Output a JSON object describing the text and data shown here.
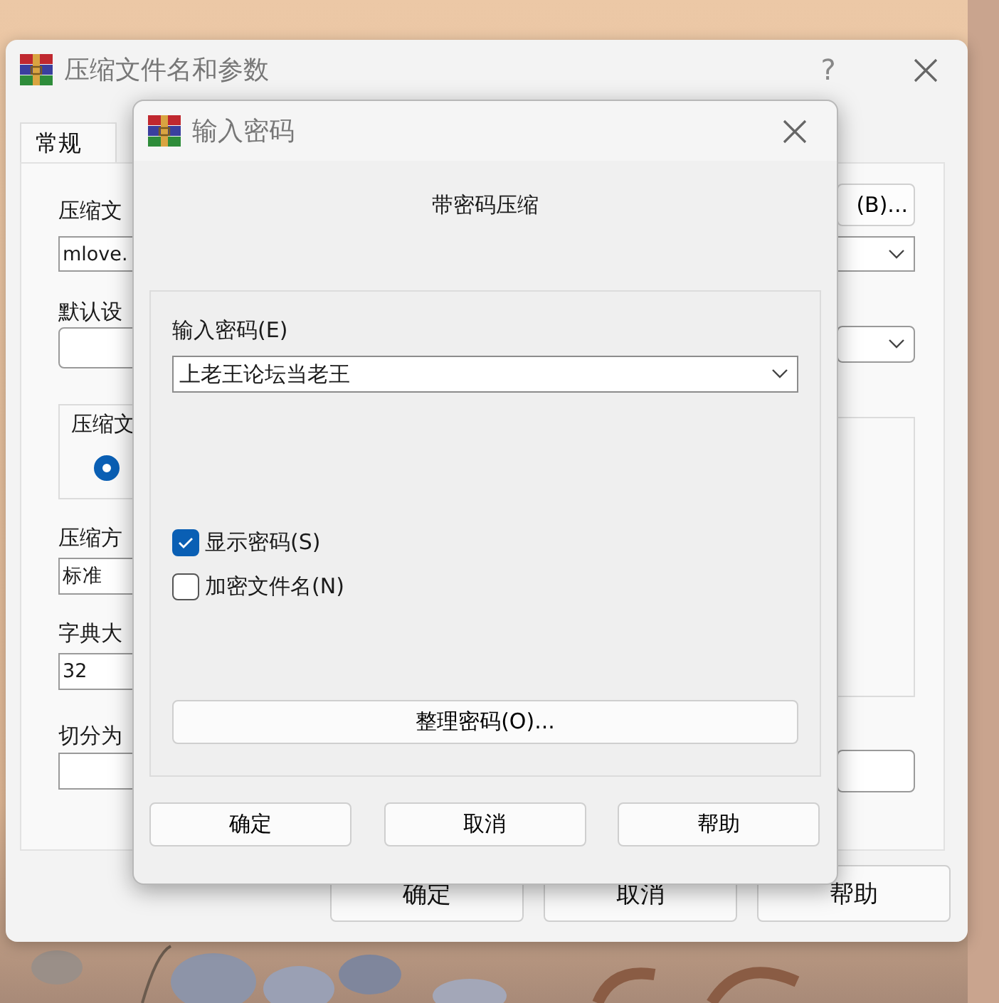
{
  "main_window": {
    "title": "压缩文件名和参数",
    "help_button": "?",
    "tabs": [
      {
        "label": "常规",
        "selected": true
      }
    ],
    "archive_name": {
      "label": "压缩文",
      "value": "mlove."
    },
    "browse_button": "(B)...",
    "profile": {
      "label": "默认设"
    },
    "archive_format": {
      "label": "压缩文",
      "radio_selected": true
    },
    "method": {
      "label": "压缩方",
      "value": "标准"
    },
    "dictionary": {
      "label": "字典大",
      "value": "32"
    },
    "split": {
      "label": "切分为"
    },
    "buttons": [
      "确定",
      "取消",
      "帮助"
    ]
  },
  "dialog": {
    "title": "输入密码",
    "heading": "带密码压缩",
    "password": {
      "label": "输入密码(E)",
      "value": "上老王论坛当老王"
    },
    "options": [
      {
        "label": "显示密码(S)",
        "checked": true
      },
      {
        "label": "加密文件名(N)",
        "checked": false
      }
    ],
    "organize_button": "整理密码(O)...",
    "buttons": [
      "确定",
      "取消",
      "帮助"
    ]
  }
}
